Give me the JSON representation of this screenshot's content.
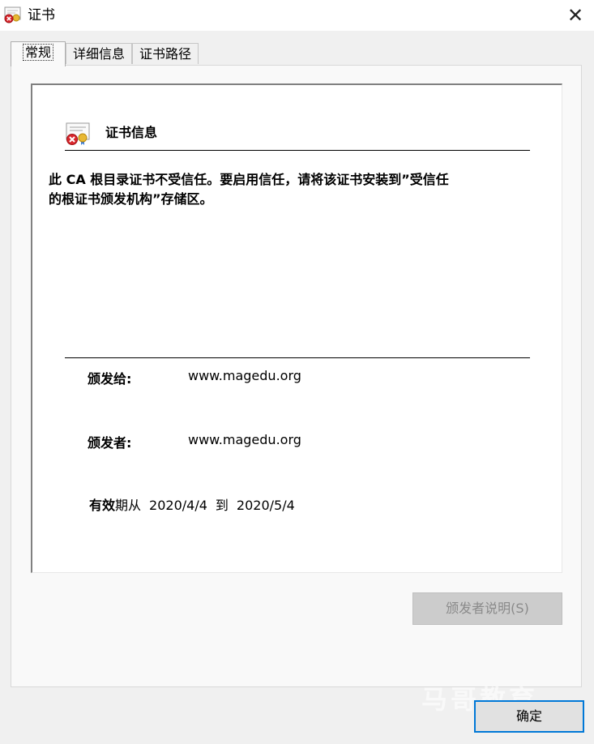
{
  "window": {
    "title": "证书",
    "close_glyph": "✕"
  },
  "tabs": [
    {
      "label": "常规",
      "active": true
    },
    {
      "label": "详细信息",
      "active": false
    },
    {
      "label": "证书路径",
      "active": false
    }
  ],
  "info": {
    "title": "证书信息",
    "warning_line1": "此 CA 根目录证书不受信任。要启用信任，请将该证书安装到”受信任",
    "warning_line2": "的根证书颁发机构”存储区。",
    "issued_to_label": "颁发给:",
    "issued_to_value": "www.magedu.org",
    "issued_by_label": "颁发者:",
    "issued_by_value": "www.magedu.org",
    "valid_label_bold": "有效",
    "valid_label_rest": "期从",
    "valid_from": "2020/4/4",
    "valid_to_word": "到",
    "valid_to": "2020/5/4"
  },
  "buttons": {
    "issuer_statement": "颁发者说明(S)",
    "ok": "确定"
  },
  "watermark": "马哥教育",
  "colors": {
    "accent": "#0078d7",
    "warning_red": "#d9262c",
    "seal_gold": "#e8b833"
  },
  "icons": {
    "app": "certificate-error-icon",
    "info": "certificate-error-icon"
  }
}
